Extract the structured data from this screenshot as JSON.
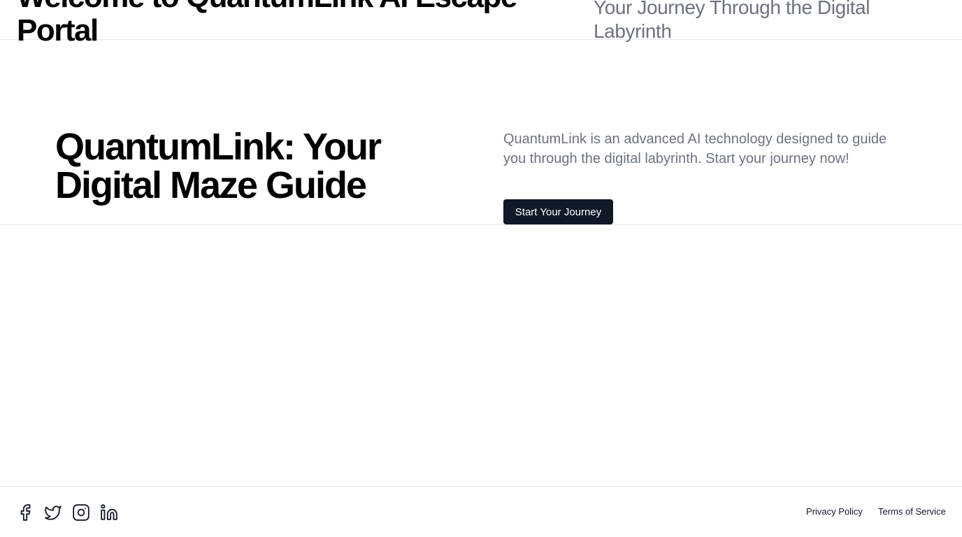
{
  "header": {
    "title": "Welcome to QuantumLink AI Escape Portal",
    "subtitle": "Your Journey Through the Digital Labyrinth"
  },
  "hero": {
    "title": "QuantumLink: Your Digital Maze Guide",
    "description": "QuantumLink is an advanced AI technology designed to guide you through the digital labyrinth. Start your journey now!",
    "button_label": "Start Your Journey"
  },
  "footer": {
    "social": [
      {
        "icon": "facebook-icon"
      },
      {
        "icon": "twitter-icon"
      },
      {
        "icon": "instagram-icon"
      },
      {
        "icon": "linkedin-icon"
      }
    ],
    "links": {
      "privacy": "Privacy Policy",
      "terms": "Terms of Service"
    }
  },
  "colors": {
    "text_primary": "#000000",
    "text_muted": "#6b7280",
    "button_bg": "#111827",
    "button_text": "#ffffff",
    "divider": "#e5e7eb"
  }
}
